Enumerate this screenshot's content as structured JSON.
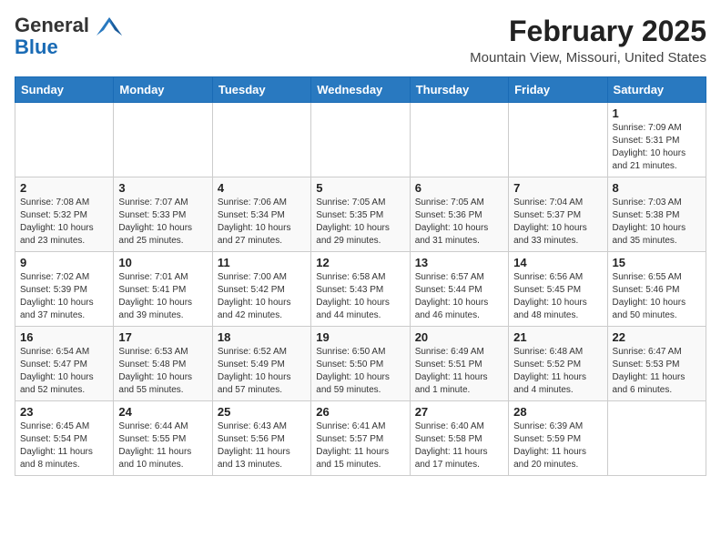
{
  "header": {
    "logo_general": "General",
    "logo_blue": "Blue",
    "title": "February 2025",
    "subtitle": "Mountain View, Missouri, United States"
  },
  "weekdays": [
    "Sunday",
    "Monday",
    "Tuesday",
    "Wednesday",
    "Thursday",
    "Friday",
    "Saturday"
  ],
  "weeks": [
    [
      {
        "day": "",
        "info": ""
      },
      {
        "day": "",
        "info": ""
      },
      {
        "day": "",
        "info": ""
      },
      {
        "day": "",
        "info": ""
      },
      {
        "day": "",
        "info": ""
      },
      {
        "day": "",
        "info": ""
      },
      {
        "day": "1",
        "info": "Sunrise: 7:09 AM\nSunset: 5:31 PM\nDaylight: 10 hours and 21 minutes."
      }
    ],
    [
      {
        "day": "2",
        "info": "Sunrise: 7:08 AM\nSunset: 5:32 PM\nDaylight: 10 hours and 23 minutes."
      },
      {
        "day": "3",
        "info": "Sunrise: 7:07 AM\nSunset: 5:33 PM\nDaylight: 10 hours and 25 minutes."
      },
      {
        "day": "4",
        "info": "Sunrise: 7:06 AM\nSunset: 5:34 PM\nDaylight: 10 hours and 27 minutes."
      },
      {
        "day": "5",
        "info": "Sunrise: 7:05 AM\nSunset: 5:35 PM\nDaylight: 10 hours and 29 minutes."
      },
      {
        "day": "6",
        "info": "Sunrise: 7:05 AM\nSunset: 5:36 PM\nDaylight: 10 hours and 31 minutes."
      },
      {
        "day": "7",
        "info": "Sunrise: 7:04 AM\nSunset: 5:37 PM\nDaylight: 10 hours and 33 minutes."
      },
      {
        "day": "8",
        "info": "Sunrise: 7:03 AM\nSunset: 5:38 PM\nDaylight: 10 hours and 35 minutes."
      }
    ],
    [
      {
        "day": "9",
        "info": "Sunrise: 7:02 AM\nSunset: 5:39 PM\nDaylight: 10 hours and 37 minutes."
      },
      {
        "day": "10",
        "info": "Sunrise: 7:01 AM\nSunset: 5:41 PM\nDaylight: 10 hours and 39 minutes."
      },
      {
        "day": "11",
        "info": "Sunrise: 7:00 AM\nSunset: 5:42 PM\nDaylight: 10 hours and 42 minutes."
      },
      {
        "day": "12",
        "info": "Sunrise: 6:58 AM\nSunset: 5:43 PM\nDaylight: 10 hours and 44 minutes."
      },
      {
        "day": "13",
        "info": "Sunrise: 6:57 AM\nSunset: 5:44 PM\nDaylight: 10 hours and 46 minutes."
      },
      {
        "day": "14",
        "info": "Sunrise: 6:56 AM\nSunset: 5:45 PM\nDaylight: 10 hours and 48 minutes."
      },
      {
        "day": "15",
        "info": "Sunrise: 6:55 AM\nSunset: 5:46 PM\nDaylight: 10 hours and 50 minutes."
      }
    ],
    [
      {
        "day": "16",
        "info": "Sunrise: 6:54 AM\nSunset: 5:47 PM\nDaylight: 10 hours and 52 minutes."
      },
      {
        "day": "17",
        "info": "Sunrise: 6:53 AM\nSunset: 5:48 PM\nDaylight: 10 hours and 55 minutes."
      },
      {
        "day": "18",
        "info": "Sunrise: 6:52 AM\nSunset: 5:49 PM\nDaylight: 10 hours and 57 minutes."
      },
      {
        "day": "19",
        "info": "Sunrise: 6:50 AM\nSunset: 5:50 PM\nDaylight: 10 hours and 59 minutes."
      },
      {
        "day": "20",
        "info": "Sunrise: 6:49 AM\nSunset: 5:51 PM\nDaylight: 11 hours and 1 minute."
      },
      {
        "day": "21",
        "info": "Sunrise: 6:48 AM\nSunset: 5:52 PM\nDaylight: 11 hours and 4 minutes."
      },
      {
        "day": "22",
        "info": "Sunrise: 6:47 AM\nSunset: 5:53 PM\nDaylight: 11 hours and 6 minutes."
      }
    ],
    [
      {
        "day": "23",
        "info": "Sunrise: 6:45 AM\nSunset: 5:54 PM\nDaylight: 11 hours and 8 minutes."
      },
      {
        "day": "24",
        "info": "Sunrise: 6:44 AM\nSunset: 5:55 PM\nDaylight: 11 hours and 10 minutes."
      },
      {
        "day": "25",
        "info": "Sunrise: 6:43 AM\nSunset: 5:56 PM\nDaylight: 11 hours and 13 minutes."
      },
      {
        "day": "26",
        "info": "Sunrise: 6:41 AM\nSunset: 5:57 PM\nDaylight: 11 hours and 15 minutes."
      },
      {
        "day": "27",
        "info": "Sunrise: 6:40 AM\nSunset: 5:58 PM\nDaylight: 11 hours and 17 minutes."
      },
      {
        "day": "28",
        "info": "Sunrise: 6:39 AM\nSunset: 5:59 PM\nDaylight: 11 hours and 20 minutes."
      },
      {
        "day": "",
        "info": ""
      }
    ]
  ]
}
